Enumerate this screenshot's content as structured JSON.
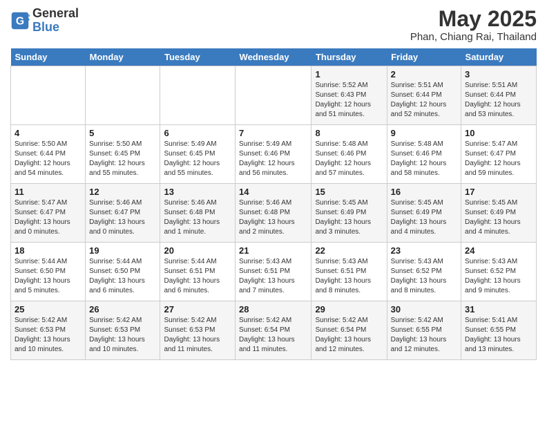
{
  "header": {
    "logo_line1": "General",
    "logo_line2": "Blue",
    "month": "May 2025",
    "location": "Phan, Chiang Rai, Thailand"
  },
  "weekdays": [
    "Sunday",
    "Monday",
    "Tuesday",
    "Wednesday",
    "Thursday",
    "Friday",
    "Saturday"
  ],
  "weeks": [
    [
      {
        "day": "",
        "info": ""
      },
      {
        "day": "",
        "info": ""
      },
      {
        "day": "",
        "info": ""
      },
      {
        "day": "",
        "info": ""
      },
      {
        "day": "1",
        "info": "Sunrise: 5:52 AM\nSunset: 6:43 PM\nDaylight: 12 hours\nand 51 minutes."
      },
      {
        "day": "2",
        "info": "Sunrise: 5:51 AM\nSunset: 6:44 PM\nDaylight: 12 hours\nand 52 minutes."
      },
      {
        "day": "3",
        "info": "Sunrise: 5:51 AM\nSunset: 6:44 PM\nDaylight: 12 hours\nand 53 minutes."
      }
    ],
    [
      {
        "day": "4",
        "info": "Sunrise: 5:50 AM\nSunset: 6:44 PM\nDaylight: 12 hours\nand 54 minutes."
      },
      {
        "day": "5",
        "info": "Sunrise: 5:50 AM\nSunset: 6:45 PM\nDaylight: 12 hours\nand 55 minutes."
      },
      {
        "day": "6",
        "info": "Sunrise: 5:49 AM\nSunset: 6:45 PM\nDaylight: 12 hours\nand 55 minutes."
      },
      {
        "day": "7",
        "info": "Sunrise: 5:49 AM\nSunset: 6:46 PM\nDaylight: 12 hours\nand 56 minutes."
      },
      {
        "day": "8",
        "info": "Sunrise: 5:48 AM\nSunset: 6:46 PM\nDaylight: 12 hours\nand 57 minutes."
      },
      {
        "day": "9",
        "info": "Sunrise: 5:48 AM\nSunset: 6:46 PM\nDaylight: 12 hours\nand 58 minutes."
      },
      {
        "day": "10",
        "info": "Sunrise: 5:47 AM\nSunset: 6:47 PM\nDaylight: 12 hours\nand 59 minutes."
      }
    ],
    [
      {
        "day": "11",
        "info": "Sunrise: 5:47 AM\nSunset: 6:47 PM\nDaylight: 13 hours\nand 0 minutes."
      },
      {
        "day": "12",
        "info": "Sunrise: 5:46 AM\nSunset: 6:47 PM\nDaylight: 13 hours\nand 0 minutes."
      },
      {
        "day": "13",
        "info": "Sunrise: 5:46 AM\nSunset: 6:48 PM\nDaylight: 13 hours\nand 1 minute."
      },
      {
        "day": "14",
        "info": "Sunrise: 5:46 AM\nSunset: 6:48 PM\nDaylight: 13 hours\nand 2 minutes."
      },
      {
        "day": "15",
        "info": "Sunrise: 5:45 AM\nSunset: 6:49 PM\nDaylight: 13 hours\nand 3 minutes."
      },
      {
        "day": "16",
        "info": "Sunrise: 5:45 AM\nSunset: 6:49 PM\nDaylight: 13 hours\nand 4 minutes."
      },
      {
        "day": "17",
        "info": "Sunrise: 5:45 AM\nSunset: 6:49 PM\nDaylight: 13 hours\nand 4 minutes."
      }
    ],
    [
      {
        "day": "18",
        "info": "Sunrise: 5:44 AM\nSunset: 6:50 PM\nDaylight: 13 hours\nand 5 minutes."
      },
      {
        "day": "19",
        "info": "Sunrise: 5:44 AM\nSunset: 6:50 PM\nDaylight: 13 hours\nand 6 minutes."
      },
      {
        "day": "20",
        "info": "Sunrise: 5:44 AM\nSunset: 6:51 PM\nDaylight: 13 hours\nand 6 minutes."
      },
      {
        "day": "21",
        "info": "Sunrise: 5:43 AM\nSunset: 6:51 PM\nDaylight: 13 hours\nand 7 minutes."
      },
      {
        "day": "22",
        "info": "Sunrise: 5:43 AM\nSunset: 6:51 PM\nDaylight: 13 hours\nand 8 minutes."
      },
      {
        "day": "23",
        "info": "Sunrise: 5:43 AM\nSunset: 6:52 PM\nDaylight: 13 hours\nand 8 minutes."
      },
      {
        "day": "24",
        "info": "Sunrise: 5:43 AM\nSunset: 6:52 PM\nDaylight: 13 hours\nand 9 minutes."
      }
    ],
    [
      {
        "day": "25",
        "info": "Sunrise: 5:42 AM\nSunset: 6:53 PM\nDaylight: 13 hours\nand 10 minutes."
      },
      {
        "day": "26",
        "info": "Sunrise: 5:42 AM\nSunset: 6:53 PM\nDaylight: 13 hours\nand 10 minutes."
      },
      {
        "day": "27",
        "info": "Sunrise: 5:42 AM\nSunset: 6:53 PM\nDaylight: 13 hours\nand 11 minutes."
      },
      {
        "day": "28",
        "info": "Sunrise: 5:42 AM\nSunset: 6:54 PM\nDaylight: 13 hours\nand 11 minutes."
      },
      {
        "day": "29",
        "info": "Sunrise: 5:42 AM\nSunset: 6:54 PM\nDaylight: 13 hours\nand 12 minutes."
      },
      {
        "day": "30",
        "info": "Sunrise: 5:42 AM\nSunset: 6:55 PM\nDaylight: 13 hours\nand 12 minutes."
      },
      {
        "day": "31",
        "info": "Sunrise: 5:41 AM\nSunset: 6:55 PM\nDaylight: 13 hours\nand 13 minutes."
      }
    ]
  ]
}
